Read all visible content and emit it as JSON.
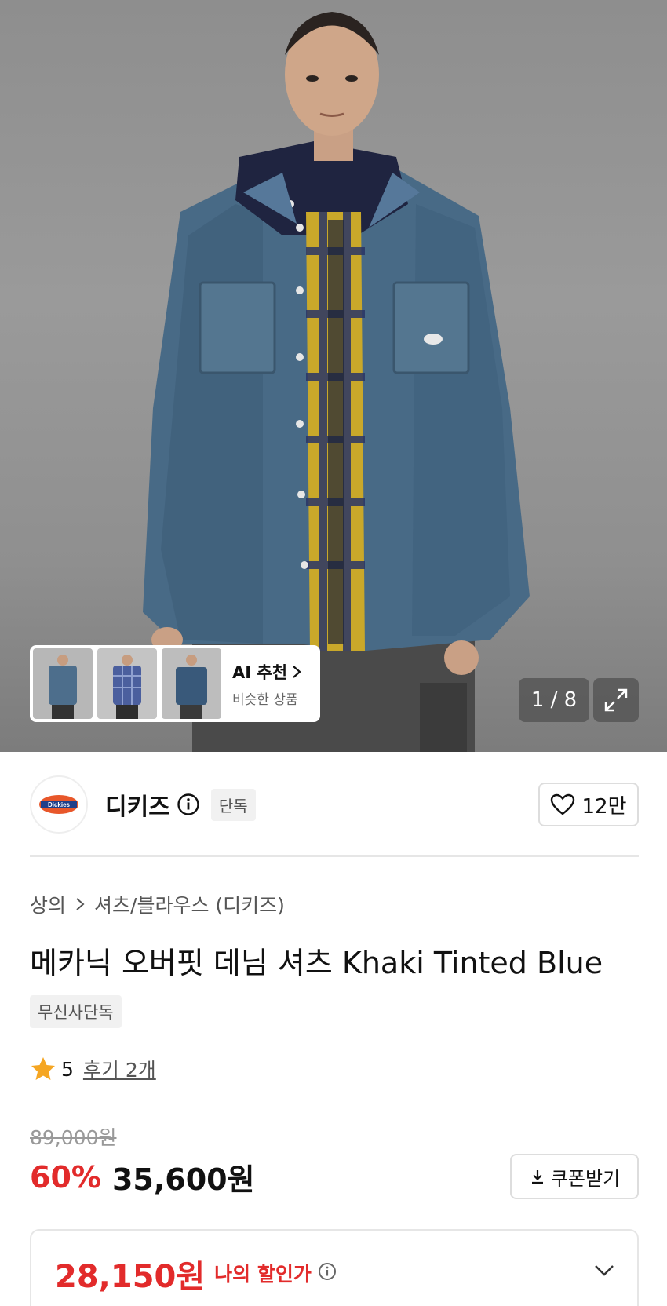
{
  "gallery": {
    "counter": "1 / 8",
    "ai": {
      "title": "AI 추천",
      "subtitle": "비슷한 상품"
    }
  },
  "brand": {
    "logo_text": "Dickies",
    "name": "디키즈",
    "badge": "단독",
    "likes": "12만"
  },
  "breadcrumb": {
    "category": "상의",
    "subcategory": "셔츠/블라우스 (디키즈)"
  },
  "product": {
    "title": "메카닉 오버핏 데님 셔츠 Khaki Tinted Blue",
    "tag": "무신사단독"
  },
  "rating": {
    "score": "5",
    "reviews": "후기 2개"
  },
  "pricing": {
    "original": "89,000원",
    "discount": "60%",
    "price": "35,600원",
    "coupon_label": "쿠폰받기",
    "my_price": "28,150원",
    "my_price_label": "나의 할인가"
  },
  "colors": {
    "accent_red": "#e22b2b",
    "star": "#f5a623"
  }
}
